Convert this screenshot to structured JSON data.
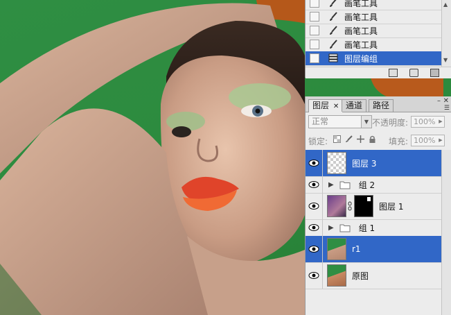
{
  "history": {
    "items": [
      {
        "label": "画笔工具",
        "icon": "brush-icon",
        "selected": false
      },
      {
        "label": "画笔工具",
        "icon": "brush-icon",
        "selected": false
      },
      {
        "label": "画笔工具",
        "icon": "brush-icon",
        "selected": false
      },
      {
        "label": "画笔工具",
        "icon": "brush-icon",
        "selected": false
      },
      {
        "label": "图层编组",
        "icon": "group-layers-icon",
        "selected": true
      }
    ],
    "footer_icons": [
      "new-document-from-state-icon",
      "snapshot-camera-icon",
      "trash-icon"
    ]
  },
  "layers_panel": {
    "tabs": [
      {
        "label": "图层",
        "active": true
      },
      {
        "label": "通道",
        "active": false
      },
      {
        "label": "路径",
        "active": false
      }
    ],
    "blend_mode": "正常",
    "opacity_label": "不透明度:",
    "opacity_value": "100%",
    "lock_label": "锁定:",
    "fill_label": "填充:",
    "fill_value": "100%",
    "layers": [
      {
        "name": "图层 3",
        "type": "layer",
        "selected": true,
        "visible": true,
        "thumb": "transparent"
      },
      {
        "name": "组 2",
        "type": "group",
        "selected": false,
        "visible": true
      },
      {
        "name": "图层 1",
        "type": "layer-with-mask",
        "selected": false,
        "visible": true,
        "thumb": "photo-purple"
      },
      {
        "name": "组 1",
        "type": "group",
        "selected": false,
        "visible": true
      },
      {
        "name": "r1",
        "type": "layer",
        "selected": true,
        "visible": true,
        "thumb": "photo-green"
      },
      {
        "name": "原图",
        "type": "layer",
        "selected": false,
        "visible": true,
        "thumb": "photo-green"
      }
    ]
  },
  "colors": {
    "selection": "#3167c7",
    "canvas_green": "#2e8b3e",
    "panel_bg": "#ececec"
  }
}
